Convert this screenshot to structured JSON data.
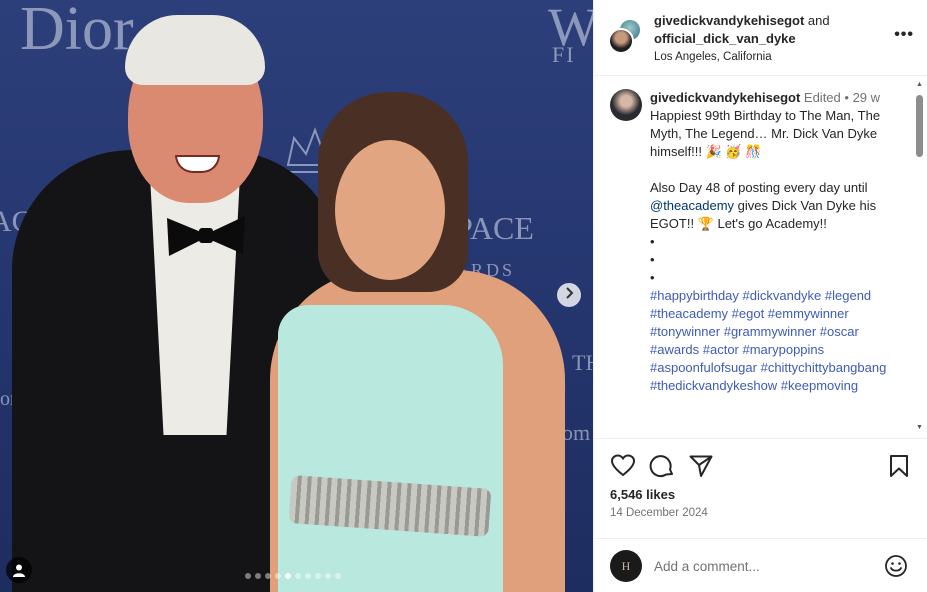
{
  "photo": {
    "backdrop": {
      "dior": "Dior",
      "w": "W",
      "fi": "FI",
      "ace_left": "ACE",
      "ace_right": "PACE",
      "ards": "ARDS",
      "th": "TH",
      "om_left": "ome",
      "om_right": "om"
    },
    "next_icon": "chevron-right",
    "carousel_count": 10,
    "carousel_active": 4
  },
  "header": {
    "account1": "givedickvandykehisegot",
    "and": " and",
    "account2": "official_dick_van_dyke",
    "location": "Los Angeles, California",
    "more": "•••"
  },
  "caption": {
    "username": "givedickvandykehisegot",
    "edited": "Edited",
    "sep": " • ",
    "age": "29 w",
    "line1": "Happiest 99th Birthday to The Man, The Myth, The Legend… Mr. Dick Van Dyke himself!!! 🎉 🥳 🎊",
    "line2_pre": "Also Day 48 of posting every day until ",
    "mention": "@theacademy",
    "line2_post": " gives Dick Van Dyke his EGOT!! 🏆 Let's go Academy!!",
    "bullets": [
      "•",
      "•",
      "•"
    ],
    "hashtags": "#happybirthday #dickvandyke #legend #theacademy #egot #emmywinner #tonywinner #grammywinner #oscar #awards #actor #marypoppins #aspoonfulofsugar #chittychittybangbang #thedickvandykeshow #keepmoving"
  },
  "actions": {
    "likes": "6,546 likes",
    "date": "14 December 2024"
  },
  "comment_box": {
    "placeholder": "Add a comment...",
    "avatar_letter": "H"
  },
  "colors": {
    "hashtag": "#3e5bb8",
    "mention": "#00376b",
    "backdrop": "#24356e",
    "dress": "#b8e8de"
  }
}
